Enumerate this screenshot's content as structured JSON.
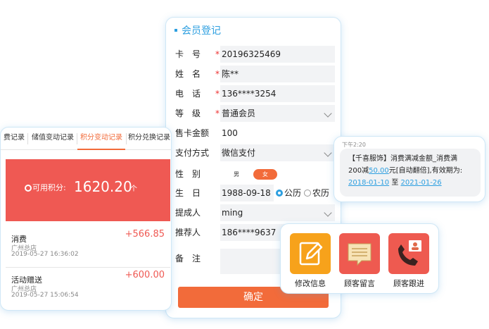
{
  "form": {
    "title": "会员登记",
    "fields": [
      {
        "label": "卡　号",
        "value": "20196325469",
        "required": true
      },
      {
        "label": "姓　名",
        "value": "陈**",
        "required": true
      },
      {
        "label": "电　话",
        "value": "136****3254",
        "required": true
      },
      {
        "label": "等　级",
        "value": "普通会员",
        "required": true
      },
      {
        "label": "售卡金额",
        "value": "100",
        "required": false
      },
      {
        "label": "支付方式",
        "value": "微信支付",
        "required": false
      },
      {
        "label": "性　别",
        "required": false
      },
      {
        "label": "生　日",
        "value": "1988-09-18",
        "required": false
      },
      {
        "label": "提成人",
        "value": "ming",
        "required": false
      },
      {
        "label": "推荐人",
        "value": "186****9637",
        "required": false
      },
      {
        "label": "备　注",
        "value": "",
        "required": false
      }
    ],
    "gender_options": [
      "男",
      "女"
    ],
    "gender_selected": "女",
    "calendar_options": [
      "公历",
      "农历"
    ],
    "calendar_selected": "公历",
    "submit_label": "确定"
  },
  "points": {
    "tabs": [
      "费记录",
      "储值变动记录",
      "积分变动记录",
      "积分兑换记录"
    ],
    "active_tab": "积分变动记录",
    "balance_label": "可用积分:",
    "balance_value": "1620.20",
    "balance_unit": "个",
    "records": [
      {
        "title": "消费",
        "store": "广州总店",
        "time": "2019-05-27 16:36:02",
        "amount": "+566.85"
      },
      {
        "title": "活动赠送",
        "store": "广州总店",
        "time": "2019-05-27 15:06:54",
        "amount": "+600.00"
      }
    ]
  },
  "sms": {
    "time": "下午2:20",
    "line1": "【千喜服饰】消费满减金额_消费满",
    "line2_pre": "200减",
    "line2_amount": "50.00",
    "line2_post": "元[自动翻倍],有效期为:",
    "date_from": "2018-01-10",
    "date_sep": "至",
    "date_to": "2021-01-26"
  },
  "actions": [
    {
      "label": "修改信息",
      "icon": "edit-icon",
      "color": "#f7a21b"
    },
    {
      "label": "顾客留言",
      "icon": "message-icon",
      "color": "#ee5a50"
    },
    {
      "label": "顾客跟进",
      "icon": "phone-contact-icon",
      "color": "#ee5a50"
    }
  ],
  "colors": {
    "accent": "#2d9fe0",
    "orange": "#f26b3a",
    "red": "#ef5953"
  }
}
